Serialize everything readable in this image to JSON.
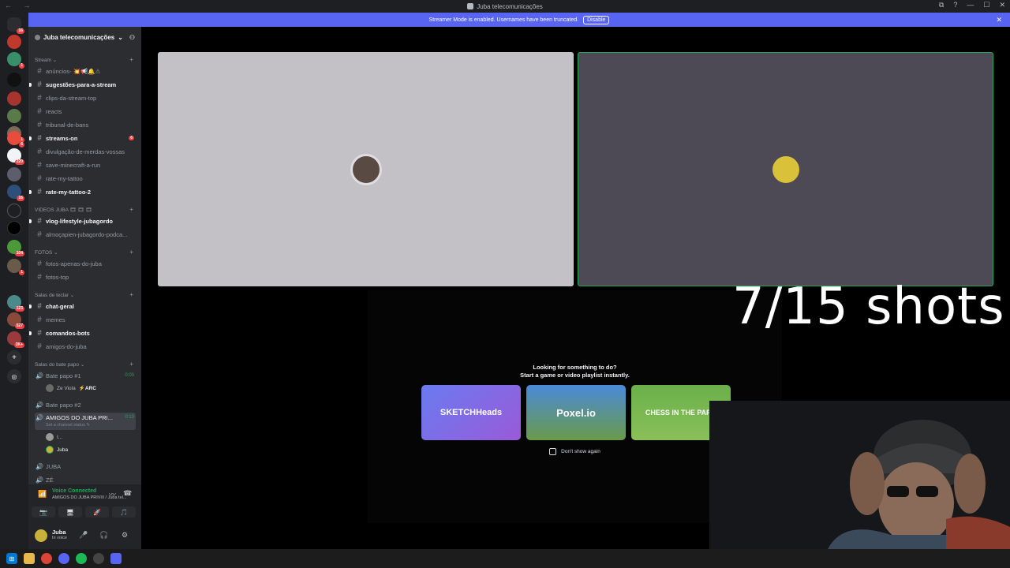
{
  "window": {
    "title": "Juba telecomunicações",
    "nav": "← →",
    "controls": [
      "⧉",
      "?",
      "—",
      "☐",
      "✕"
    ]
  },
  "banner": {
    "text": "Streamer Mode is enabled. Usernames have been truncated.",
    "button": "Disable",
    "close": "✕"
  },
  "guild_badges": {
    "g1": "16",
    "g3": "1",
    "g7": "1",
    "g8": "6",
    "g9": "220",
    "g11": "16",
    "g14": "104",
    "g15": "1",
    "g16": "123",
    "g17": "527",
    "g18": "3K+"
  },
  "server": {
    "name": "Juba telecomunicações",
    "chevron": "⌄",
    "add_member_icon": "person-add-icon"
  },
  "categories": {
    "stream": "Stream ⌄",
    "videos": "VIDEOS JUBA 🎞 🎞 🎞",
    "fotos": "FOTOS ⌄",
    "salas_teclar": "Salas de teclar ⌄",
    "salas_bate": "Salas do bate papo ⌄"
  },
  "channels": {
    "anuncios": "anúncios- 💥📢🔔⚠",
    "sugestoes": "sugestões-para-a-stream",
    "clips": "clips-da-stream-top",
    "reacts": "reacts",
    "tribunal": "tribunal-de-bans",
    "streams_on": "streams-on",
    "streams_on_mentions": "6",
    "divulgacao": "divulgação-de-merdas-vossas",
    "save_minecraft": "save-minecraft-a-run",
    "rate_tattoo": "rate-my-tattoo",
    "rate_tattoo2": "rate-my-tattoo-2",
    "vlog": "vlog-lifestyle-jubagordo",
    "almocapien": "almoçapien-jubagordo-podca...",
    "fotos_apenas": "fotos-apenas-do-juba",
    "fotos_top": "fotos-top",
    "chat_geral": "chat-geral",
    "memes": "memes",
    "comandos": "comandos-bots",
    "amigos": "amigos-do-juba"
  },
  "voice_channels": {
    "bate1": "Bate papo #1",
    "bate1_time": "0:00",
    "bate1_user": "Ze Viola",
    "bate1_user_tag": "⚡ARC",
    "bate2": "Bate papo #2",
    "amigos_priv": "AMIGOS DO JUBA PRI...",
    "amigos_priv_time": "0:13",
    "amigos_priv_status": "Set a channel status ✎",
    "user_i": "I...",
    "user_juba": "Juba",
    "juba_ch": "JUBA",
    "ze_ch": "ZÉ"
  },
  "voice_panel": {
    "status": "Voice Connected",
    "sub": "AMIGOS DO JUBA PRIVIII / Juba tel...",
    "btn_camera": "📷",
    "btn_screen": "🖥",
    "btn_activity": "🚀",
    "btn_soundboard": "🎵"
  },
  "user_panel": {
    "name": "Juba",
    "status": "In voice"
  },
  "activity": {
    "title1": "Looking for something to do?",
    "title2": "Start a game or video playlist instantly.",
    "cards": [
      "SKETCHHeads",
      "Poxel.io",
      "CHESS IN THE PARK"
    ],
    "dont_show": "Don't show again"
  },
  "overlay": {
    "text": "7/15 shots"
  },
  "colors": {
    "accent": "#5865f2",
    "online": "#23a55a",
    "mention": "#f23f43"
  }
}
